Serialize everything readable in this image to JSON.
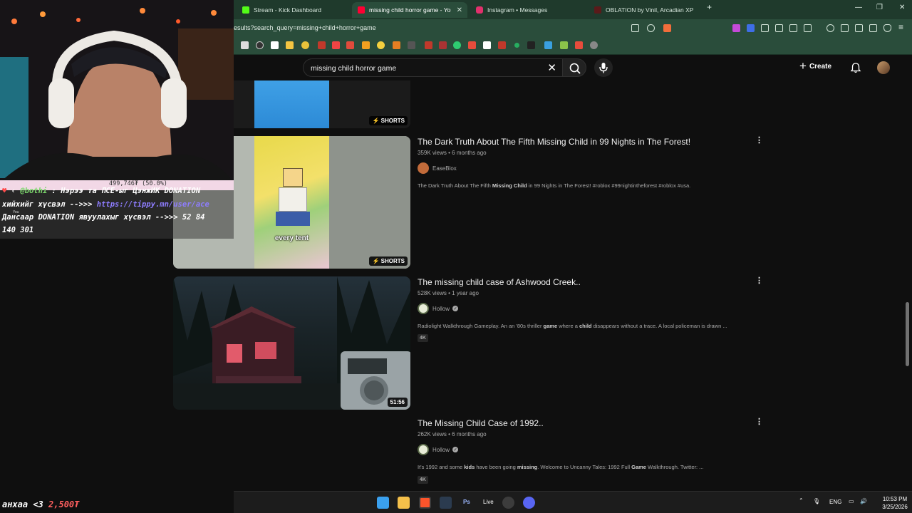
{
  "browser": {
    "tabs": [
      {
        "label": "Stream - Kick Dashboard",
        "color": "#53fc18"
      },
      {
        "label": "missing child horror game - You",
        "color": "#ff0033"
      },
      {
        "label": "Instagram • Messages",
        "color": "#e1306c"
      },
      {
        "label": "OBLATION by Vinil, Arcadian XP",
        "color": "#5a1a1a"
      }
    ],
    "new_tab": "+",
    "url": "esults?search_query=missing+child+horror+game"
  },
  "youtube": {
    "search_query": "missing child horror game",
    "create_label": "Create"
  },
  "results": [
    {
      "title": "",
      "badge": "SHORTS"
    },
    {
      "title": "The Dark Truth About The Fifth Missing Child in 99 Nights in The Forest!",
      "meta": "359K views • 6 months ago",
      "channel": "EaseBlox",
      "desc_pre": "The Dark Truth About The Fifth ",
      "desc_bold": "Missing Child",
      "desc_post": " in 99 Nights in The Forest! #roblox #99nightintheforest #roblox #usa.",
      "badge": "SHORTS",
      "caption": "every tent"
    },
    {
      "title": "The missing child case of Ashwood Creek..",
      "meta": "528K views • 1 year ago",
      "channel": "Hollow",
      "desc_1": "Radiolight Walkthrough Gameplay. An an '80s thriller ",
      "desc_b1": "game",
      "desc_2": " where a ",
      "desc_b2": "child",
      "desc_3": " disappears without a trace. A local policeman is drawn ...",
      "chip": "4K",
      "duration": "51:56"
    },
    {
      "title": "The Missing Child Case of 1992..",
      "meta": "262K views • 6 months ago",
      "channel": "Hollow",
      "desc_1": "It's 1992 and some ",
      "desc_b1": "kids",
      "desc_2": " have been going ",
      "desc_b2": "missing",
      "desc_3": ". Welcome to Uncanny Tales: 1992 Full ",
      "desc_b3": "Game",
      "desc_4": " Walkthrough. Twitter: ...",
      "chip": "4K"
    }
  ],
  "overlay": {
    "amount": "499,746₮ (50.0%)",
    "chat_line1_user": "@bothi",
    "chat_line1_rest": " : Нэрээ та ПСЕ-ыг ЦэнжИК DONATION",
    "chat_line2_pre": "хийхийг хүсвэл -->>> ",
    "chat_line2_link": "https://tippy.mn/user/ace",
    "chat_line3": "Дансаар DONATION явуулахыг хүсвэл -->>> 52 84",
    "chat_line4": "140 301",
    "you_label": "You"
  },
  "donation": {
    "text": "анхаа <3 ",
    "amount": "2,500₮"
  },
  "taskbar": {
    "live_label": "Live",
    "lang": "ENG",
    "time": "10:53 PM",
    "date": "3/25/2026"
  }
}
